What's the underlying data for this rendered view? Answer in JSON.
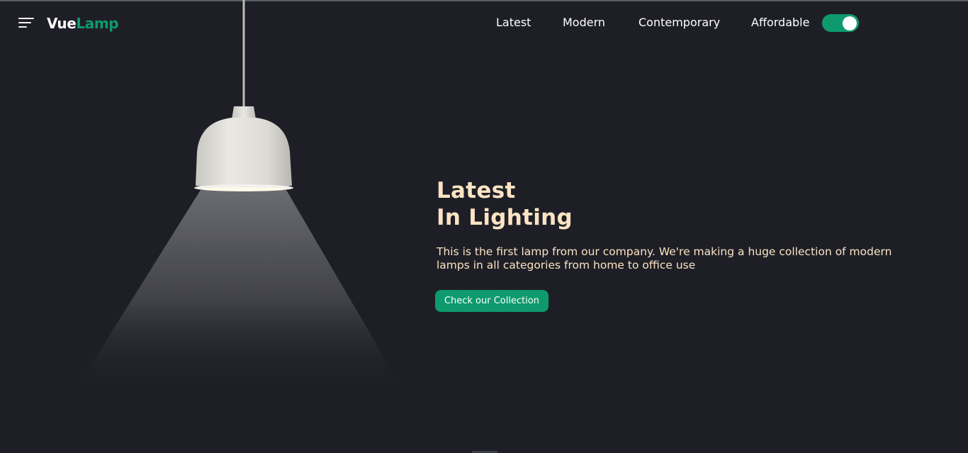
{
  "header": {
    "logo": {
      "part1": "Vue",
      "part2": "Lamp"
    },
    "menu_icon": "hamburger-menu-icon",
    "nav": [
      {
        "label": "Latest"
      },
      {
        "label": "Modern"
      },
      {
        "label": "Contemporary"
      },
      {
        "label": "Affordable"
      }
    ],
    "theme_toggle": {
      "state": "on"
    }
  },
  "hero": {
    "title_line1": "Latest",
    "title_line2": "In Lighting",
    "description": "This is the first lamp from our company. We're making a huge collection of modern lamps in all categories from home to office use",
    "cta_label": "Check our Collection"
  },
  "colors": {
    "background": "#1e1f26",
    "accent": "#0e9a6d",
    "heading_text": "#fbe3c4",
    "lamp_shade": "#e6e4df"
  }
}
